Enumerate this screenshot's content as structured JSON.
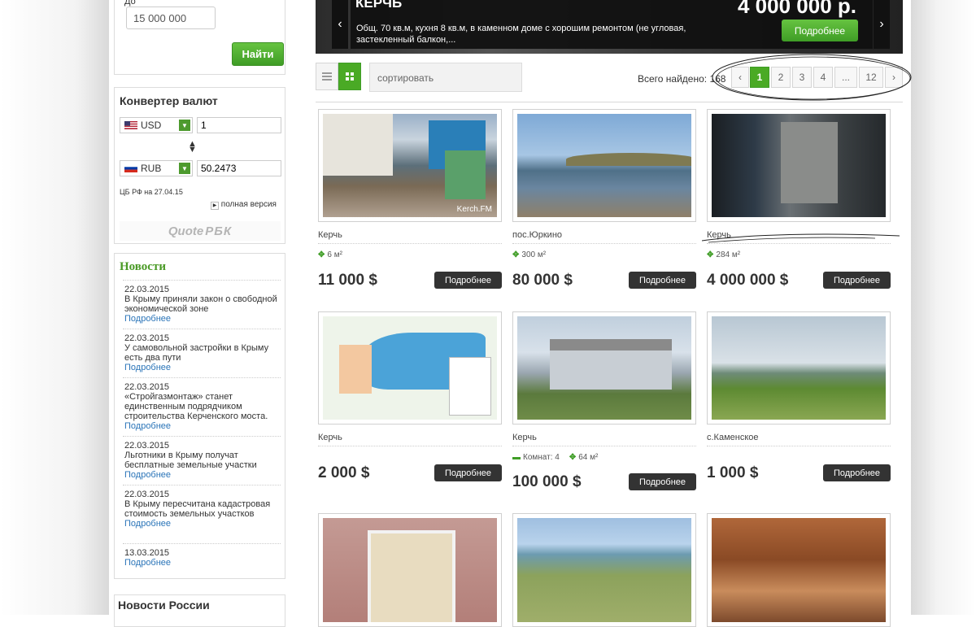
{
  "search": {
    "to_label": "До",
    "to_value": "15 000 000",
    "find_label": "Найти"
  },
  "converter": {
    "title": "Конвертер валют",
    "from_currency": "USD",
    "from_value": "1",
    "to_currency": "RUB",
    "to_value": "50.2473",
    "source": "ЦБ РФ на 27.04.15",
    "full_version": "полная версия",
    "quote_label": "Quote",
    "rbk_label": "РБК"
  },
  "news": {
    "title": "Новости",
    "more_label": "Подробнее",
    "items": [
      {
        "date": "22.03.2015",
        "text": "В Крыму приняли закон о свободной экономической зоне"
      },
      {
        "date": "22.03.2015",
        "text": "У самовольной застройки в Крыму есть два пути"
      },
      {
        "date": "22.03.2015",
        "text": "«Стройгазмонтаж» станет единственным подрядчиком строительства Керченского моста."
      },
      {
        "date": "22.03.2015",
        "text": "Льготники в Крыму получат бесплатные земельные участки"
      },
      {
        "date": "22.03.2015",
        "text": "В Крыму пересчитана кадастровая стоимость земельных участков"
      },
      {
        "date": "13.03.2015",
        "text": ""
      }
    ],
    "russia_title": "Новости России"
  },
  "slider": {
    "city": "КЕРЧЬ",
    "price": "4 000 000 р.",
    "text": "Общ. 70 кв.м, кухня 8 кв.м, в каменном доме с хорошим ремонтом (не угловая, застекленный балкон,...",
    "more_label": "Подробнее",
    "prev": "‹",
    "next": "›"
  },
  "toolbar": {
    "sort_label": "сортировать",
    "found_label": "Всего найдено: 168",
    "pages": [
      "‹",
      "1",
      "2",
      "3",
      "4",
      "...",
      "12",
      "›"
    ],
    "active_page": "1"
  },
  "listings": [
    {
      "city": "Керчь",
      "meta": [
        {
          "icon": "area-icon",
          "value": "6 м²"
        }
      ],
      "price": "11 000 $",
      "more": "Подробнее"
    },
    {
      "city": "пос.Юркино",
      "meta": [
        {
          "icon": "area-icon",
          "value": "300 м²"
        }
      ],
      "price": "80 000 $",
      "more": "Подробнее"
    },
    {
      "city": "Керчь",
      "meta": [
        {
          "icon": "area-icon",
          "value": "284 м²"
        }
      ],
      "price": "4 000 000 $",
      "more": "Подробнее"
    },
    {
      "city": "Керчь",
      "meta": [],
      "price": "2 000 $",
      "more": "Подробнее"
    },
    {
      "city": "Керчь",
      "meta": [
        {
          "icon": "rooms-icon",
          "value": "Комнат: 4"
        },
        {
          "icon": "area-icon",
          "value": "64 м²"
        }
      ],
      "price": "100 000 $",
      "more": "Подробнее"
    },
    {
      "city": "с.Каменское",
      "meta": [],
      "price": "1 000 $",
      "more": "Подробнее"
    },
    {
      "city": "",
      "meta": [],
      "price": "",
      "more": ""
    },
    {
      "city": "",
      "meta": [],
      "price": "",
      "more": ""
    },
    {
      "city": "",
      "meta": [],
      "price": "",
      "more": ""
    }
  ],
  "colors": {
    "accent": "#4aaa25",
    "news_title": "#4a9a26",
    "link": "#2a74b8",
    "dark_button": "#333333"
  },
  "watermark": "Kerch.FM"
}
